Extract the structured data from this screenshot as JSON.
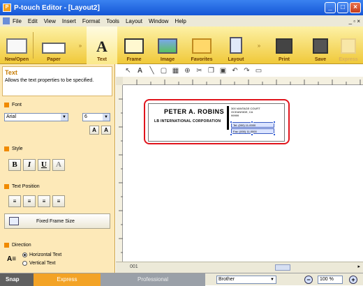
{
  "window": {
    "title": "P-touch Editor - [Layout2]"
  },
  "menu": [
    "File",
    "Edit",
    "View",
    "Insert",
    "Format",
    "Tools",
    "Layout",
    "Window",
    "Help"
  ],
  "toolbar": [
    {
      "label": "New/Open",
      "icon": "new-open-icon"
    },
    {
      "label": "Paper",
      "icon": "paper-icon"
    },
    {
      "label": "Text",
      "icon": "text-icon"
    },
    {
      "label": "Frame",
      "icon": "frame-icon"
    },
    {
      "label": "Image",
      "icon": "image-icon"
    },
    {
      "label": "Favorites",
      "icon": "favorites-icon"
    },
    {
      "label": "Layout",
      "icon": "layout-icon"
    },
    {
      "label": "Print",
      "icon": "print-icon"
    },
    {
      "label": "Save",
      "icon": "save-icon"
    },
    {
      "label": "Express",
      "icon": "express-icon"
    }
  ],
  "panel": {
    "title": "Text",
    "description": "Allows the text properties to be specified.",
    "font_section": "Font",
    "font_name": "Arial",
    "font_size": "6",
    "style_section": "Style",
    "position_section": "Text Position",
    "fixed_frame": "Fixed Frame Size",
    "direction_section": "Direction",
    "horizontal": "Horizontal Text",
    "vertical": "Vertical Text"
  },
  "label": {
    "name": "PETER A. ROBINS",
    "company": "LB INTERNATIONAL CORPORATION",
    "address1": "300 VANTAGE COURT",
    "address2": "OCEANSIDE, CA",
    "address3": "99999",
    "tel": "Tel: (000) 11-0000",
    "fax": "Fax: (000) 11-0000"
  },
  "status": {
    "snap": "Snap",
    "express": "Express",
    "professional": "Professional",
    "printer": "Brother",
    "zoom": "100 %",
    "page": "001"
  }
}
